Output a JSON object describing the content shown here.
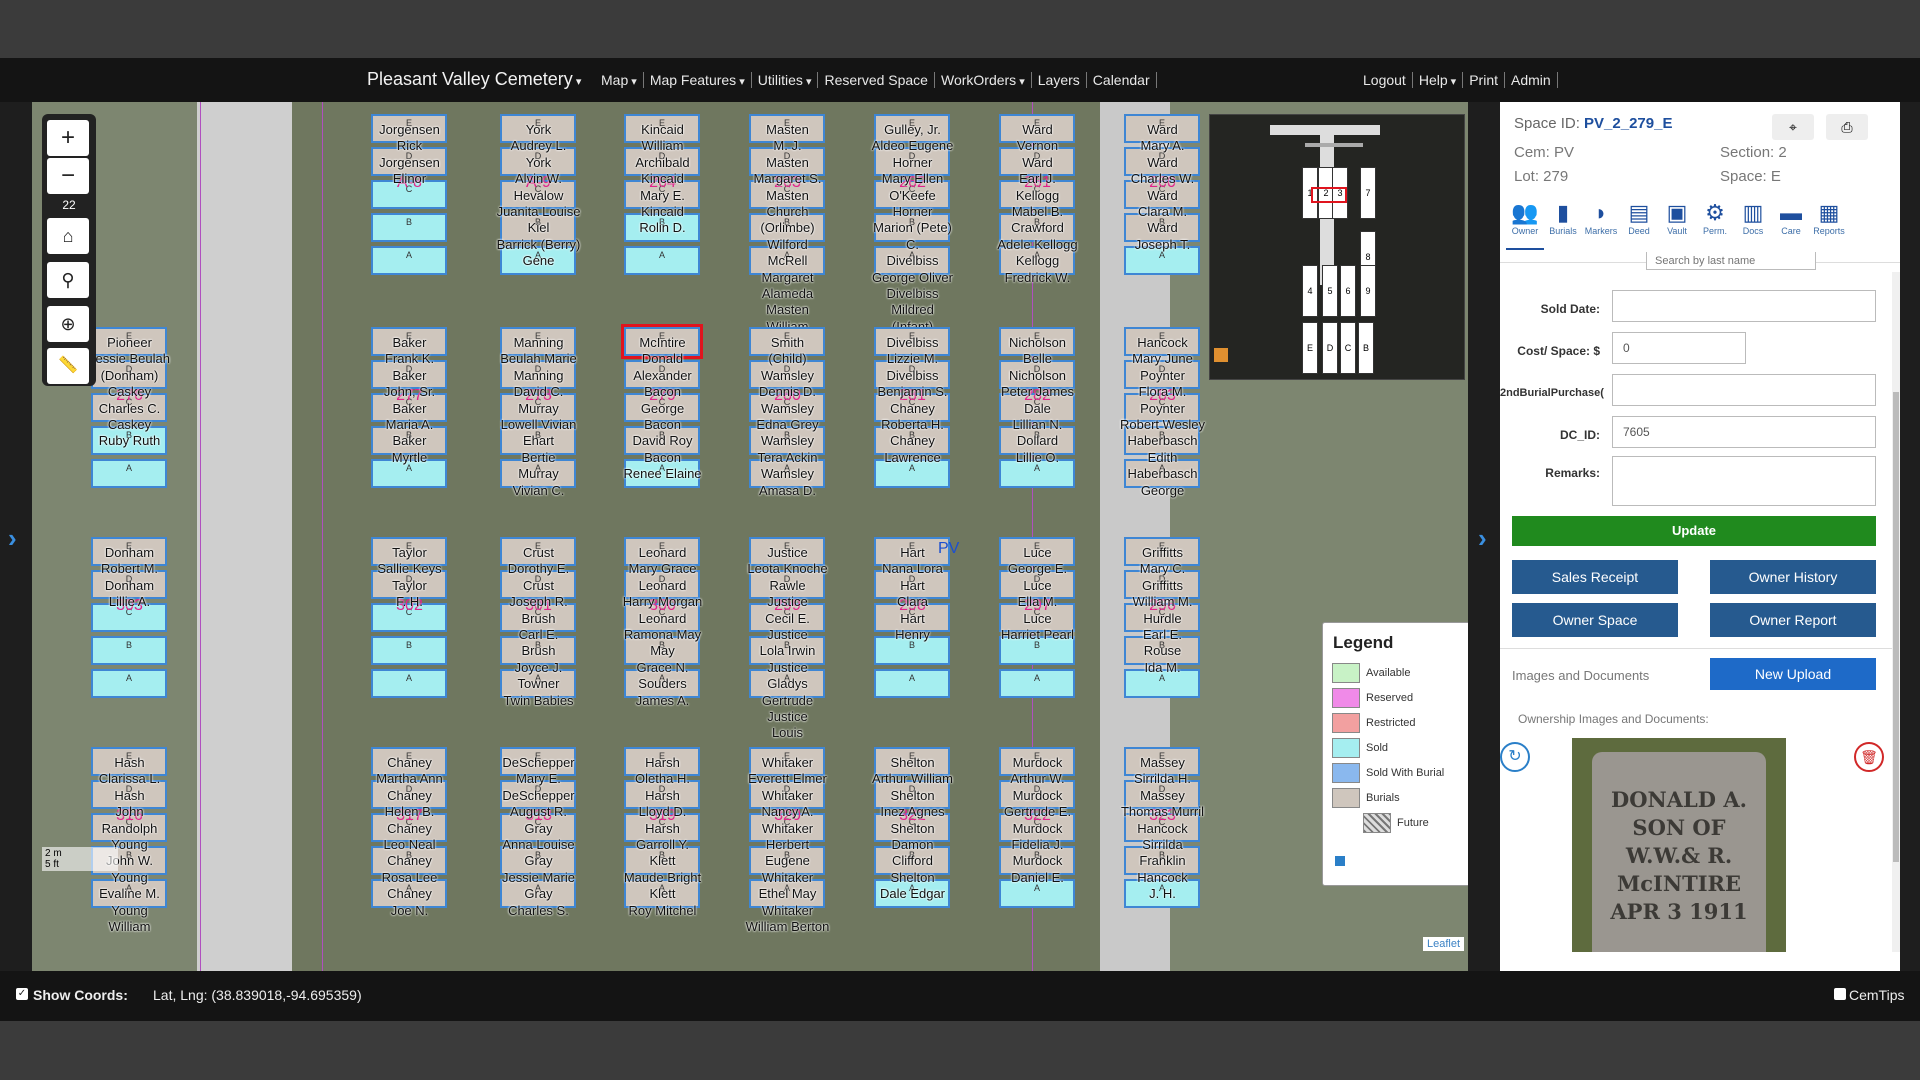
{
  "nav": {
    "brand": "Pleasant Valley Cemetery",
    "menu": [
      "Map",
      "Map Features",
      "Utilities",
      "Reserved Space",
      "WorkOrders",
      "Layers",
      "Calendar"
    ],
    "right_menu": [
      "Logout",
      "Help",
      "Print",
      "Admin"
    ]
  },
  "map": {
    "zoom_in": "+",
    "zoom_out": "−",
    "zoom_level": "22",
    "pv_label": "PV",
    "leaflet_label": "Leaflet",
    "scale_m": "2 m",
    "scale_ft": "5 ft",
    "lots": [
      {
        "num": "A-8",
        "names": [
          "Jorgensen",
          "Rick",
          "Jorgensen",
          "Elinor"
        ]
      },
      {
        "num": "A-9",
        "names": [
          "York",
          "Audrey L.",
          "York",
          "Alvin W.",
          "Hevalow",
          "Juanita Louise",
          "Kiel",
          "Barrick (Berry) Gene"
        ]
      },
      {
        "num": "264",
        "names": [
          "Kincaid",
          "William Archibald",
          "Kincaid",
          "Mary E.",
          "Kincaid",
          "Rolin D."
        ]
      },
      {
        "num": "263",
        "names": [
          "Masten",
          "M. J.",
          "Masten",
          "Margaret S.",
          "Masten",
          "Church (Orlimbe) Wilford",
          "McRell",
          "Margaret Alameda",
          "Masten",
          "William"
        ]
      },
      {
        "num": "262",
        "names": [
          "Gulley, Jr.",
          "Aldeo Eugene",
          "Horner",
          "Mary Ellen O'Keefe",
          "Horner",
          "Marion (Pete) C.",
          "Divelbiss",
          "George Oliver",
          "Divelbiss",
          "Mildred (Infant)"
        ]
      },
      {
        "num": "261",
        "names": [
          "Ward",
          "Vernon",
          "Ward",
          "Earl J.",
          "Kellogg",
          "Mabel B.",
          "Crawford",
          "Adele Kellogg",
          "Kellogg",
          "Fredrick W."
        ]
      },
      {
        "num": "260",
        "names": [
          "Ward",
          "Mary A.",
          "Ward",
          "Charles W.",
          "Ward",
          "Clara M.",
          "Ward",
          "Joseph T."
        ]
      },
      {
        "num": "277",
        "names": [
          "Baker",
          "Frank K.",
          "Baker",
          "John, Sr.",
          "Baker",
          "Maria A.",
          "Baker",
          "Myrtle"
        ]
      },
      {
        "num": "278",
        "names": [
          "Manning",
          "Beulah Marie",
          "Manning",
          "David C.",
          "Murray",
          "Lowell Vivian",
          "Ehart",
          "Bertie",
          "Murray",
          "Vivian C."
        ]
      },
      {
        "num": "279",
        "names": [
          "McIntire",
          "Donald Alexander",
          "Bacon",
          "George",
          "Bacon",
          "David Roy",
          "Bacon",
          "Renee Elaine"
        ]
      },
      {
        "num": "280",
        "names": [
          "Smith",
          "(Child)",
          "Wamsley",
          "Dennis D.",
          "Wamsley",
          "Edna Grey",
          "Wamsley",
          "Tera Ackin",
          "Wamsley",
          "Amasa D."
        ]
      },
      {
        "num": "281",
        "names": [
          "Divelbiss",
          "Lizzie M.",
          "Divelbiss",
          "Benjamin S.",
          "Chaney",
          "Roberta H.",
          "Chaney",
          "Lawrence"
        ]
      },
      {
        "num": "282",
        "names": [
          "Nicholson",
          "Belle",
          "Nicholson",
          "Peter James",
          "Dale",
          "Lillian N.",
          "Dollard",
          "Lillie O."
        ]
      },
      {
        "num": "283",
        "names": [
          "Hancock",
          "Mary June",
          "Poynter",
          "Flora M.",
          "Poynter",
          "Robert Wesley",
          "Haberbasch",
          "Edith",
          "Haberbasch",
          "George"
        ]
      },
      {
        "num": "302",
        "names": [
          "Taylor",
          "Sallie Keys",
          "Taylor",
          "F. H."
        ]
      },
      {
        "num": "301",
        "names": [
          "Crust",
          "Dorothy E.",
          "Crust",
          "Joseph R.",
          "Brush",
          "Carl E.",
          "Brush",
          "Joyce J.",
          "Towner",
          "Twin Babies"
        ]
      },
      {
        "num": "300",
        "names": [
          "Leonard",
          "Mary Grace",
          "Leonard",
          "Harry Morgan",
          "Leonard",
          "Ramona May",
          "May",
          "Grace N.",
          "Souders",
          "James A."
        ]
      },
      {
        "num": "299",
        "names": [
          "Justice",
          "Leota Knoche Rawle",
          "Justice",
          "Cecil E.",
          "Justice",
          "Lola Irwin",
          "Justice",
          "Gladys Gertrude",
          "Justice",
          "Louis"
        ]
      },
      {
        "num": "298",
        "names": [
          "Hart",
          "Nana Lora",
          "Hart",
          "Clara",
          "Hart",
          "Henry"
        ]
      },
      {
        "num": "297",
        "names": [
          "Luce",
          "George E.",
          "Luce",
          "Ella M.",
          "Luce",
          "Harriet Pearl"
        ]
      },
      {
        "num": "296",
        "names": [
          "Griffitts",
          "Mary C.",
          "Griffitts",
          "William M.",
          "Hurdle",
          "Earl E.",
          "Rouse",
          "Ida M."
        ]
      },
      {
        "num": "317",
        "names": [
          "Chaney",
          "Martha Ann",
          "Chaney",
          "Helen B.",
          "Chaney",
          "Leo Neal",
          "Chaney",
          "Rosa Lee",
          "Chaney",
          "Joe N."
        ]
      },
      {
        "num": "318",
        "names": [
          "DeSchepper",
          "Mary E.",
          "DeSchepper",
          "August R.",
          "Gray",
          "Anna Louise",
          "Gray",
          "Jessie Marie",
          "Gray",
          "Charles S."
        ]
      },
      {
        "num": "319",
        "names": [
          "Harsh",
          "Oletha H.",
          "Harsh",
          "Lloyd D.",
          "Harsh",
          "Garroll Y.",
          "Klett",
          "Maude Bright",
          "Klett",
          "Roy Mitchel"
        ]
      },
      {
        "num": "320",
        "names": [
          "Whitaker",
          "Everett Elmer",
          "Whitaker",
          "Nancy A.",
          "Whitaker",
          "Herbert Eugene",
          "Whitaker",
          "Ethel May",
          "Whitaker",
          "William Berton"
        ]
      },
      {
        "num": "321",
        "names": [
          "Shelton",
          "Arthur William",
          "Shelton",
          "Inez Agnes",
          "Shelton",
          "Damon Clifford",
          "Shelton",
          "Dale Edgar"
        ]
      },
      {
        "num": "322",
        "names": [
          "Murdock",
          "Arthur W.",
          "Murdock",
          "Gertrude E.",
          "Murdock",
          "Fidelia J.",
          "Murdock",
          "Daniel E."
        ]
      },
      {
        "num": "323",
        "names": [
          "Massey",
          "Sirrilda H.",
          "Massey",
          "Thomas Murril",
          "Hancock",
          "Sirrilda Franklin",
          "Hancock",
          "J. H."
        ]
      }
    ],
    "left_lots": [
      {
        "num": "276",
        "names": [
          "Pioneer",
          "Jessie Beulah (Donham)",
          "Caskey",
          "Charles C.",
          "Caskey",
          "Ruby Ruth"
        ]
      },
      {
        "num": "303",
        "names": [
          "Donham",
          "Robert M.",
          "Donham",
          "Lillie A."
        ]
      },
      {
        "num": "316",
        "names": [
          "Hash",
          "Clarissa L.",
          "Hash",
          "John Randolph",
          "Young",
          "John W.",
          "Young",
          "Evaline M.",
          "Young",
          "William"
        ]
      }
    ],
    "cell_letters": [
      "E",
      "D",
      "C",
      "B",
      "A"
    ]
  },
  "minimap": {
    "labels": [
      "1",
      "2",
      "3",
      "7",
      "8",
      "9",
      "4",
      "5",
      "6",
      "E",
      "D",
      "C",
      "B"
    ]
  },
  "legend": {
    "title": "Legend",
    "items": [
      {
        "label": "Available",
        "color": "#c8f2c6"
      },
      {
        "label": "Reserved",
        "color": "#f08ae8"
      },
      {
        "label": "Restricted",
        "color": "#f2a0a0"
      },
      {
        "label": "Sold",
        "color": "#a5eef0"
      },
      {
        "label": "Sold With Burial",
        "color": "#8ab8ee"
      },
      {
        "label": "Burials",
        "color": "#cfc6bd"
      },
      {
        "label": "Future",
        "color": "#cccccc"
      }
    ]
  },
  "panel": {
    "space_id_label": "Space ID:",
    "space_id": "PV_2_279_E",
    "cem": "Cem: PV",
    "section": "Section: 2",
    "lot": "Lot: 279",
    "space": "Space: E",
    "tabs": [
      "Owner",
      "Burials",
      "Markers",
      "Deed",
      "Vault",
      "Perm.",
      "Docs",
      "Care",
      "Reports"
    ],
    "search_placeholder": "Search by last name",
    "sold_date_label": "Sold Date:",
    "sold_date": "",
    "cost_label": "Cost/ Space: $",
    "cost": "0",
    "second_burial_label": "2ndBurialPurchase(",
    "second_burial": "",
    "dc_id_label": "DC_ID:",
    "dc_id": "7605",
    "remarks_label": "Remarks:",
    "remarks": "",
    "update": "Update",
    "sales_receipt": "Sales Receipt",
    "owner_history": "Owner History",
    "owner_space": "Owner Space",
    "owner_report": "Owner Report",
    "images_docs": "Images and Documents",
    "new_upload": "New Upload",
    "ownership_images": "Ownership Images and Documents:",
    "stone_text": [
      "DONALD A.",
      "SON OF",
      "W.W.& R.",
      "McINTIRE",
      "APR 3 1911"
    ]
  },
  "status": {
    "show_coords": "Show Coords:",
    "latlng": "Lat, Lng: (38.839018,-94.695359)",
    "cemtips": "CemTips"
  }
}
